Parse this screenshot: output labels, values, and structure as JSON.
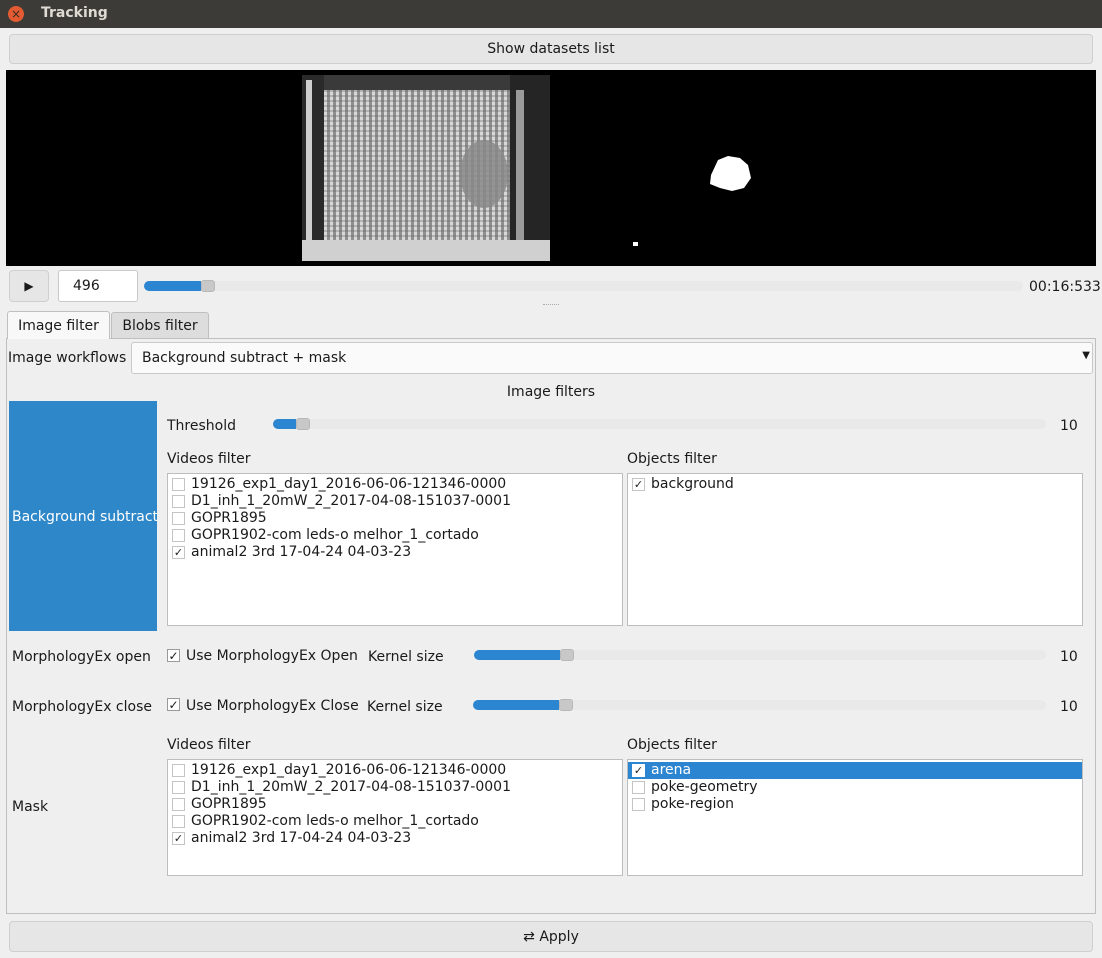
{
  "window": {
    "title": "Tracking",
    "close_icon": "×"
  },
  "top_button": "Show datasets list",
  "player": {
    "play_icon": "▶",
    "frame": "496",
    "progress_fraction": 0.065,
    "time": "00:16:533"
  },
  "tabs": [
    "Image filter",
    "Blobs filter"
  ],
  "workflow": {
    "label": "Image workflows",
    "value": "Background subtract + mask"
  },
  "filters_header": "Image filters",
  "background_subtract": {
    "label": "Background subtract",
    "threshold_label": "Threshold",
    "threshold_value": "10",
    "threshold_fraction": 0.03,
    "videos_filter_label": "Videos filter",
    "objects_filter_label": "Objects filter",
    "videos": [
      {
        "name": "19126_exp1_day1_2016-06-06-121346-0000",
        "checked": false
      },
      {
        "name": "D1_inh_1_20mW_2_2017-04-08-151037-0001",
        "checked": false
      },
      {
        "name": "GOPR1895",
        "checked": false
      },
      {
        "name": "GOPR1902-com leds-o melhor_1_cortado",
        "checked": false
      },
      {
        "name": "animal2 3rd 17-04-24 04-03-23",
        "checked": true
      }
    ],
    "objects": [
      {
        "name": "background",
        "checked": true,
        "selected": false
      }
    ]
  },
  "morph_open": {
    "label": "MorphologyEx open",
    "checkbox_label": "Use MorphologyEx Open",
    "kernel_label": "Kernel size",
    "value": "10",
    "fraction": 0.15
  },
  "morph_close": {
    "label": "MorphologyEx close",
    "checkbox_label": "Use MorphologyEx Close",
    "kernel_label": "Kernel size",
    "value": "10",
    "fraction": 0.15
  },
  "mask": {
    "label": "Mask",
    "videos_filter_label": "Videos filter",
    "objects_filter_label": "Objects filter",
    "videos": [
      {
        "name": "19126_exp1_day1_2016-06-06-121346-0000",
        "checked": false
      },
      {
        "name": "D1_inh_1_20mW_2_2017-04-08-151037-0001",
        "checked": false
      },
      {
        "name": "GOPR1895",
        "checked": false
      },
      {
        "name": "GOPR1902-com leds-o melhor_1_cortado",
        "checked": false
      },
      {
        "name": "animal2 3rd 17-04-24 04-03-23",
        "checked": true
      }
    ],
    "objects": [
      {
        "name": "arena",
        "checked": true,
        "selected": true
      },
      {
        "name": "poke-geometry",
        "checked": false,
        "selected": false
      },
      {
        "name": "poke-region",
        "checked": false,
        "selected": false
      }
    ]
  },
  "apply_button": {
    "icon": "apply-icon",
    "label": "Apply"
  },
  "checkmark": "✓",
  "colors": {
    "accent": "#2c85d1",
    "sidebar_highlight": "#2d87c9"
  }
}
